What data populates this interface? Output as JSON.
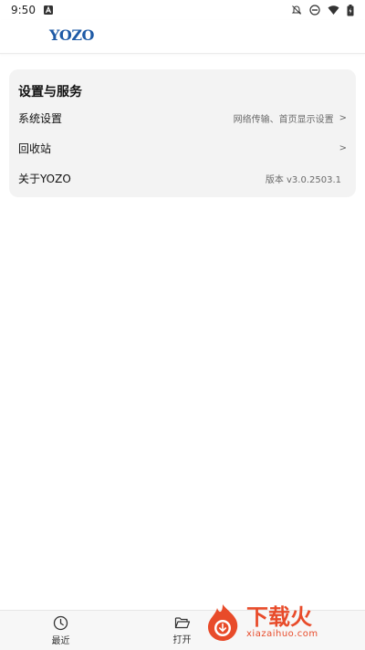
{
  "status_bar": {
    "time": "9:50",
    "icons": [
      "app-icon",
      "bell-off-icon",
      "dnd-icon",
      "wifi-icon",
      "battery-icon"
    ]
  },
  "header": {
    "logo": "YOZO"
  },
  "settings": {
    "title": "设置与服务",
    "rows": [
      {
        "label": "系统设置",
        "value": "网络传输、首页显示设置",
        "chevron": ">"
      },
      {
        "label": "回收站",
        "value": "",
        "chevron": ">"
      },
      {
        "label": "关于YOZO",
        "value": "版本 v3.0.2503.1",
        "chevron": ""
      }
    ]
  },
  "bottom_nav": {
    "tabs": [
      {
        "label": "最近",
        "icon": "clock-icon"
      },
      {
        "label": "打开",
        "icon": "folder-open-icon"
      }
    ]
  },
  "watermark": {
    "title": "下载火",
    "url": "xiazaihuo.com",
    "accent": "#e84b2a"
  }
}
